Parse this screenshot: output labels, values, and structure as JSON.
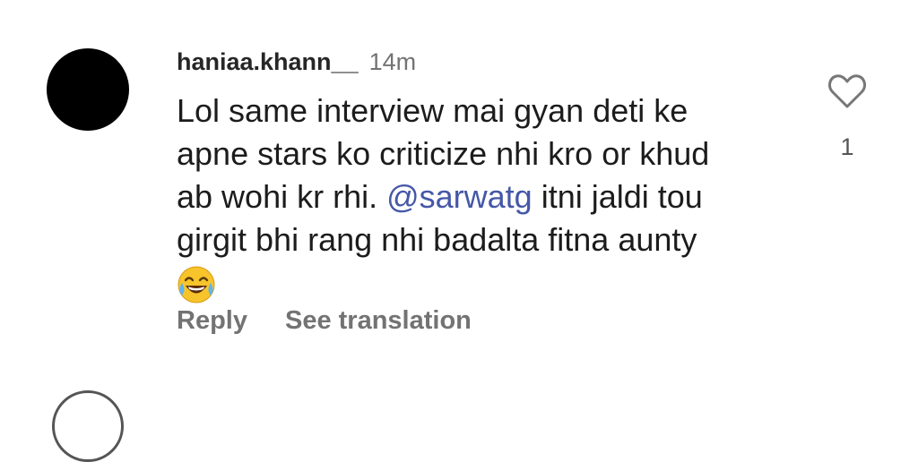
{
  "comment": {
    "username": "haniaa.khann__",
    "timestamp": "14m",
    "lines": [
      {
        "text": "Lol same interview mai gyan deti ke"
      },
      {
        "text": "apne stars ko criticize nhi kro or khud"
      },
      {
        "pre": "ab wohi kr rhi. ",
        "mention": "@sarwatg",
        "post": " itni jaldi tou"
      },
      {
        "text": "girgit bhi rang nhi badalta fitna aunty"
      }
    ],
    "emoji": "face-with-tears-of-joy",
    "like_count": "1",
    "actions": {
      "reply": "Reply",
      "translate": "See translation"
    }
  },
  "icons": {
    "like": "heart-outline-icon",
    "avatar": "black-circle-avatar"
  },
  "colors": {
    "mention": "#4557a8",
    "muted": "#737373",
    "text": "#1c1c1c"
  }
}
